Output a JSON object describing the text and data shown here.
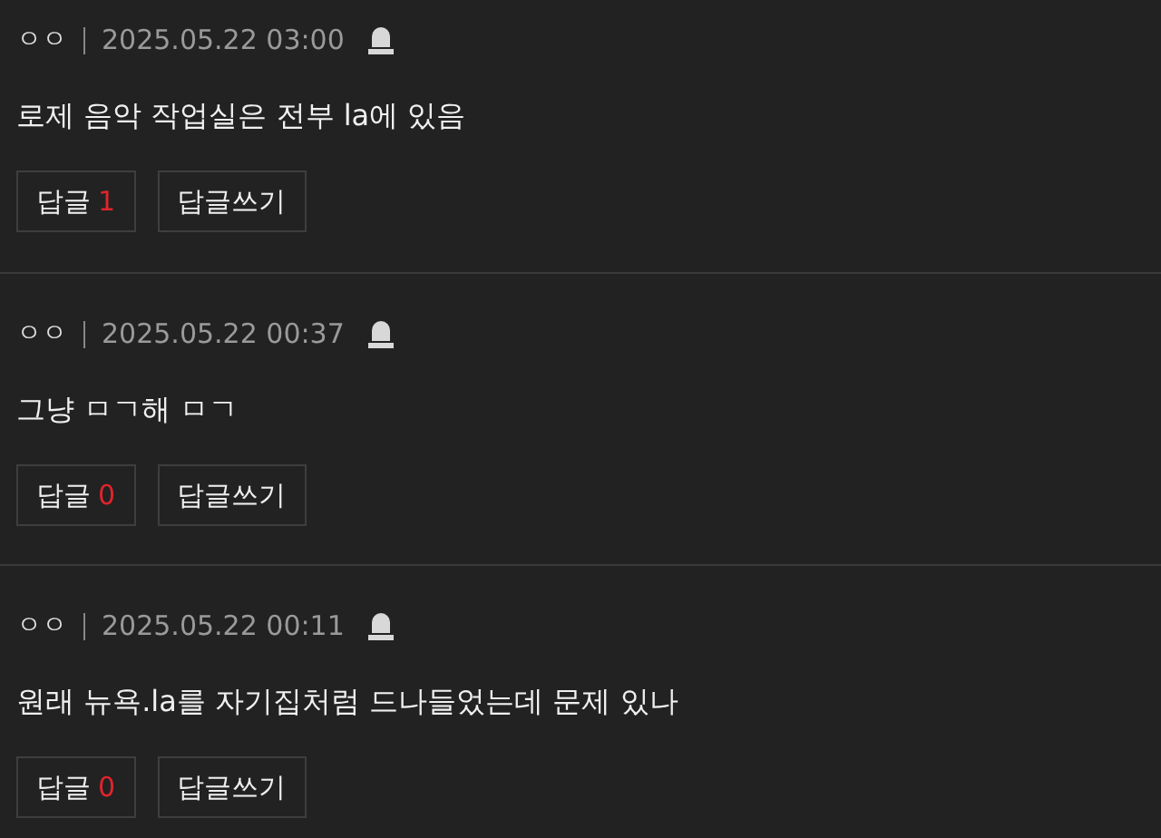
{
  "comments": [
    {
      "author": "ㅇㅇ",
      "time": "2025.05.22 03:00",
      "text": "로제 음악 작업실은 전부 la에 있음",
      "reply_label": "답글",
      "reply_count": "1",
      "write_label": "답글쓰기"
    },
    {
      "author": "ㅇㅇ",
      "time": "2025.05.22 00:37",
      "text": "그냥 ㅁㄱ해 ㅁㄱ",
      "reply_label": "답글",
      "reply_count": "0",
      "write_label": "답글쓰기"
    },
    {
      "author": "ㅇㅇ",
      "time": "2025.05.22 00:11",
      "text": "원래 뉴욕.la를 자기집처럼 드나들었는데 문제 있나",
      "reply_label": "답글",
      "reply_count": "0",
      "write_label": "답글쓰기"
    }
  ]
}
